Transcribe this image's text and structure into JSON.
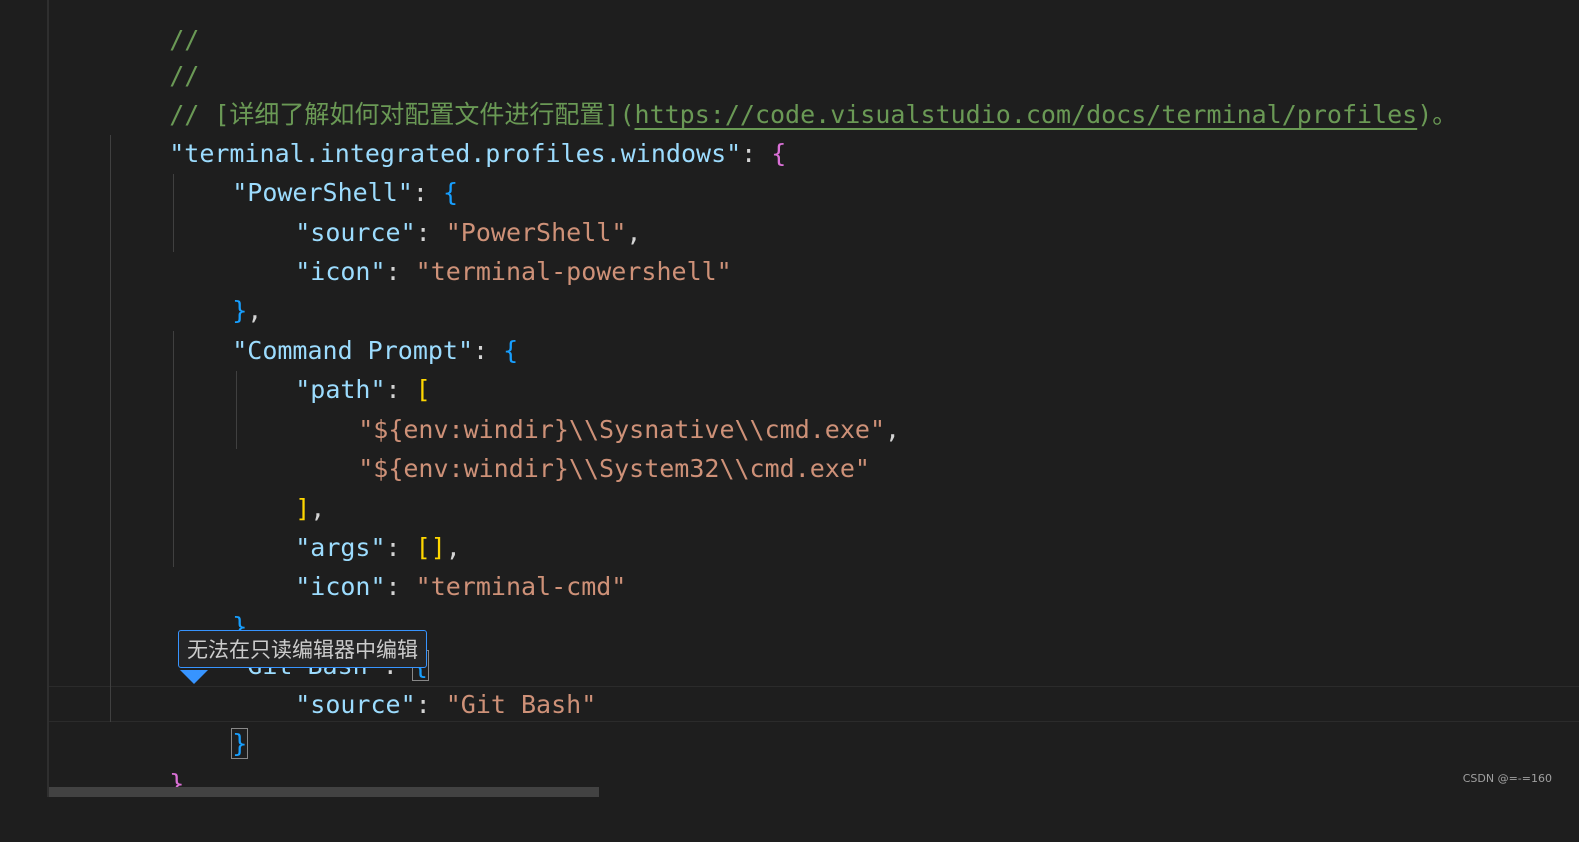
{
  "lines": [
    {
      "comment": "//"
    },
    {
      "comment": "//"
    },
    {
      "prefix": "// [详细了解如何对配置文件进行配置](",
      "link": "https://code.visualstudio.com/docs/terminal/profiles",
      "suffix": ")。"
    },
    {
      "key": "\"terminal.integrated.profiles.windows\"",
      "colon": ": ",
      "open": "{"
    },
    {
      "key": "\"PowerShell\"",
      "colon": ": ",
      "open": "{"
    },
    {
      "key": "\"source\"",
      "colon": ": ",
      "value": "\"PowerShell\"",
      "comma": ","
    },
    {
      "key": "\"icon\"",
      "colon": ": ",
      "value": "\"terminal-powershell\""
    },
    {
      "close": "}",
      "comma": ","
    },
    {
      "key": "\"Command Prompt\"",
      "colon": ": ",
      "open": "{"
    },
    {
      "key": "\"path\"",
      "colon": ": ",
      "open": "["
    },
    {
      "value": "\"${env:windir}\\\\Sysnative\\\\cmd.exe\"",
      "comma": ","
    },
    {
      "value": "\"${env:windir}\\\\System32\\\\cmd.exe\""
    },
    {
      "close": "]",
      "comma": ","
    },
    {
      "key": "\"args\"",
      "colon": ": ",
      "value": "[]",
      "comma": ","
    },
    {
      "key": "\"icon\"",
      "colon": ": ",
      "value": "\"terminal-cmd\""
    },
    {
      "close": "}",
      "comma": ","
    },
    {
      "key": "\"Git Bash\"",
      "colon": ": ",
      "open": "{"
    },
    {
      "key": "\"source\"",
      "colon": ": ",
      "value": "\"Git Bash\""
    },
    {
      "close": "}"
    },
    {
      "close": "}",
      "comma": ","
    }
  ],
  "tooltip": {
    "text": "无法在只读编辑器中编辑"
  },
  "watermark": "CSDN @=-=160"
}
